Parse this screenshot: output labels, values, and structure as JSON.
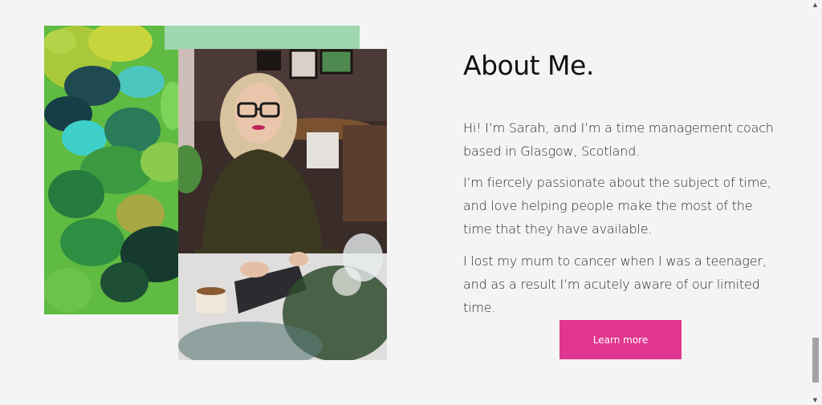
{
  "about": {
    "heading": "About Me.",
    "paragraphs": [
      "Hi! I’m Sarah, and I’m a time management coach based in Glasgow, Scotland.",
      "I’m fiercely passionate about the subject of time, and love helping people make the most of the time that they have available.",
      "I lost my mum to cancer when I was a teenager, and as a result I’m acutely aware of our limited time."
    ],
    "cta_label": "Learn more"
  },
  "colors": {
    "background": "#f4f4f4",
    "accent": "#e0368f",
    "heading": "#111111",
    "body_text": "#2b2b2b"
  },
  "icons": {
    "scroll_up": "triangle-up-icon",
    "scroll_down": "triangle-down-icon"
  }
}
